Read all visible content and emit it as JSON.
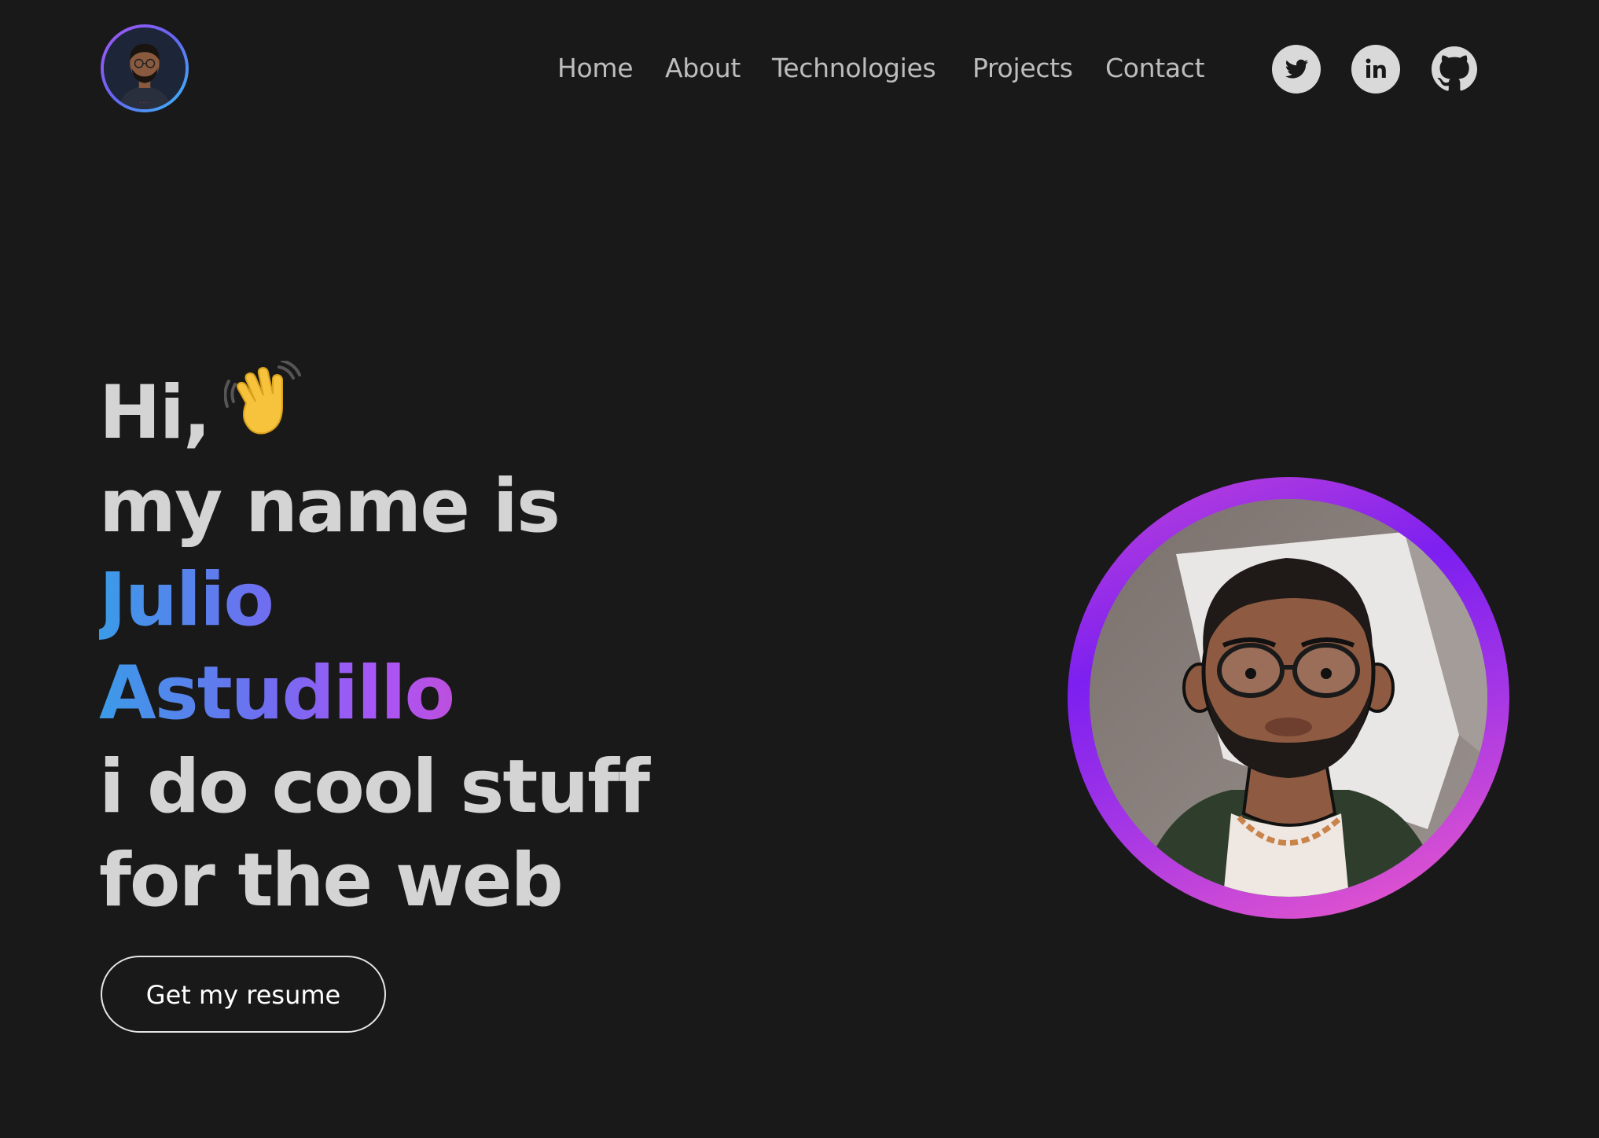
{
  "header": {
    "logo_icon": "memoji-avatar-icon",
    "nav": [
      {
        "label": "Home"
      },
      {
        "label": "About"
      },
      {
        "label": "Technologies"
      },
      {
        "label": "Projects"
      },
      {
        "label": "Contact"
      }
    ],
    "social": [
      {
        "icon": "twitter-icon"
      },
      {
        "icon": "linkedin-icon"
      },
      {
        "icon": "github-icon"
      }
    ]
  },
  "hero": {
    "greeting": "Hi,",
    "wave_emoji": "waving-hand-icon",
    "line2": "my name is",
    "first_name": "Julio",
    "last_name": "Astudillo",
    "line5": "i do cool stuff",
    "line6": "for the web",
    "resume_label": "Get my resume"
  },
  "colors": {
    "background": "#191919",
    "text": "#d4d4d4",
    "gradient_start": "#3b9be8",
    "gradient_end": "#c04fd8",
    "ring_start": "#7c1ff0",
    "ring_end": "#f05cc8"
  }
}
